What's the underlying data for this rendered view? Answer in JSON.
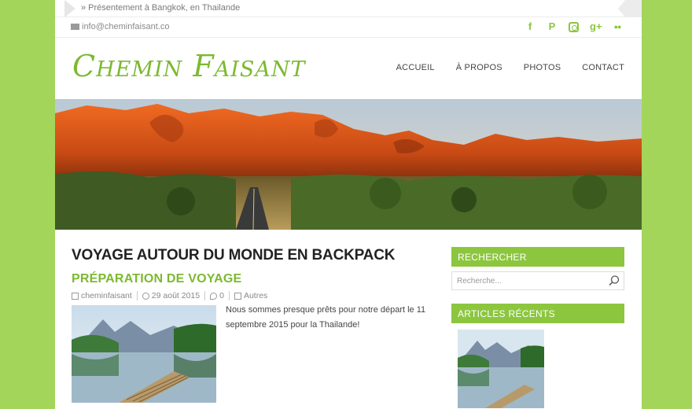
{
  "ticker": {
    "text": "» Présentement à Bangkok, en Thailande"
  },
  "topbar": {
    "email": "info@cheminfaisant.co",
    "social": [
      {
        "icon": "facebook-icon",
        "glyph": "f"
      },
      {
        "icon": "pinterest-icon",
        "glyph": "P"
      },
      {
        "icon": "instagram-icon",
        "glyph": ""
      },
      {
        "icon": "google-plus-icon",
        "glyph": "g+"
      },
      {
        "icon": "flickr-icon",
        "glyph": "●●"
      }
    ]
  },
  "header": {
    "logo": "Chemin Faisant",
    "nav": [
      "ACCUEIL",
      "À PROPOS",
      "PHOTOS",
      "CONTACT"
    ]
  },
  "main": {
    "page_title": "VOYAGE AUTOUR DU MONDE EN BACKPACK",
    "post": {
      "title": "PRÉPARATION DE VOYAGE",
      "author": "cheminfaisant",
      "date": "29 août 2015",
      "comments": "0",
      "category": "Autres",
      "excerpt": "Nous sommes presque prêts pour notre départ le 11 septembre 2015 pour la Thailande!"
    }
  },
  "sidebar": {
    "search_title": "RECHERCHER",
    "search_placeholder": "Recherche...",
    "recent_title": "ARTICLES RÉCENTS"
  },
  "colors": {
    "background": "#a3d55a",
    "accent": "#8cc63f",
    "logo": "#7cb930"
  }
}
